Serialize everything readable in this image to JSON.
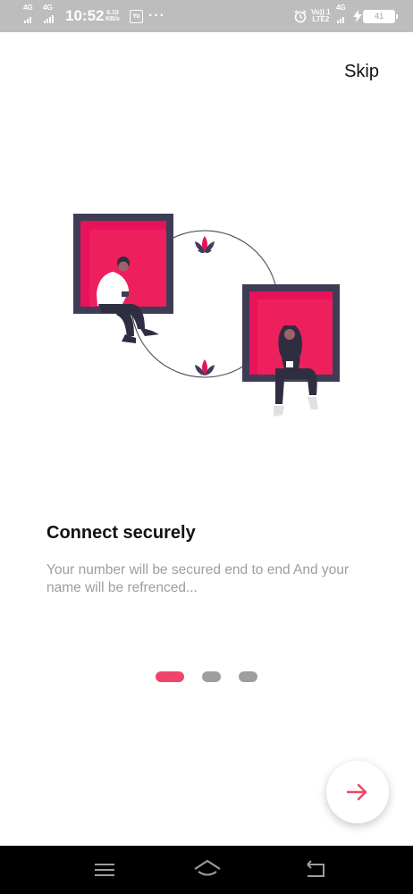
{
  "status_bar": {
    "sim1_network": "4G",
    "sim2_network": "4G",
    "time": "10:52",
    "speed_value": "0.10",
    "speed_unit": "KB/s",
    "sim_badge": "Yo",
    "more": "···",
    "volte_top": "Vo)) 1",
    "volte_bottom": "LTE2",
    "network_right": "4G",
    "battery": "41",
    "icons": [
      "signal-icon",
      "alarm-icon",
      "charging-icon",
      "battery-icon"
    ]
  },
  "header": {
    "skip_label": "Skip"
  },
  "slide": {
    "title": "Connect securely",
    "description": "Your number will be secured end to end And your name will be refrenced...",
    "illustration_icon": "connect-people-illustration"
  },
  "pager": {
    "count": 3,
    "active_index": 0,
    "active_color": "#f0446a",
    "inactive_color": "#9e9e9e"
  },
  "next_button": {
    "icon": "arrow-right-icon",
    "color": "#f0446a"
  },
  "nav_bar": {
    "items": [
      "menu-icon",
      "home-icon",
      "back-icon"
    ]
  },
  "colors": {
    "accent": "#f0446a",
    "illustration_pink": "#e8125a",
    "frame_dark": "#3f3d56"
  }
}
